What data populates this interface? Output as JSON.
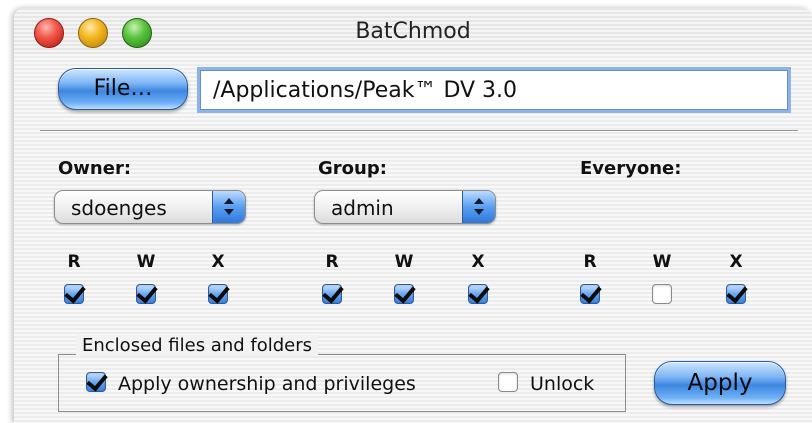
{
  "window": {
    "title": "BatChmod"
  },
  "toolbar": {
    "file_button_label": "File…",
    "path_value": "/Applications/Peak™ DV 3.0"
  },
  "owner": {
    "label": "Owner:",
    "value": "sdoenges",
    "perms": {
      "r_label": "R",
      "w_label": "W",
      "x_label": "X",
      "r": true,
      "w": true,
      "x": true
    }
  },
  "group": {
    "label": "Group:",
    "value": "admin",
    "perms": {
      "r_label": "R",
      "w_label": "W",
      "x_label": "X",
      "r": true,
      "w": true,
      "x": true
    }
  },
  "everyone": {
    "label": "Everyone:",
    "perms": {
      "r_label": "R",
      "w_label": "W",
      "x_label": "X",
      "r": true,
      "w": false,
      "x": true
    }
  },
  "enclosed": {
    "legend": "Enclosed files and folders",
    "apply_ownership_label": "Apply ownership and privileges",
    "apply_ownership_checked": true,
    "unlock_label": "Unlock",
    "unlock_checked": false
  },
  "actions": {
    "apply_label": "Apply"
  },
  "colors": {
    "accent": "#3d86e0",
    "close": "#f2574a",
    "minimize": "#f4b720",
    "zoom": "#5cc440"
  },
  "icons": [
    "close-icon",
    "minimize-icon",
    "zoom-icon",
    "popup-arrows-icon",
    "checkmark-icon"
  ]
}
